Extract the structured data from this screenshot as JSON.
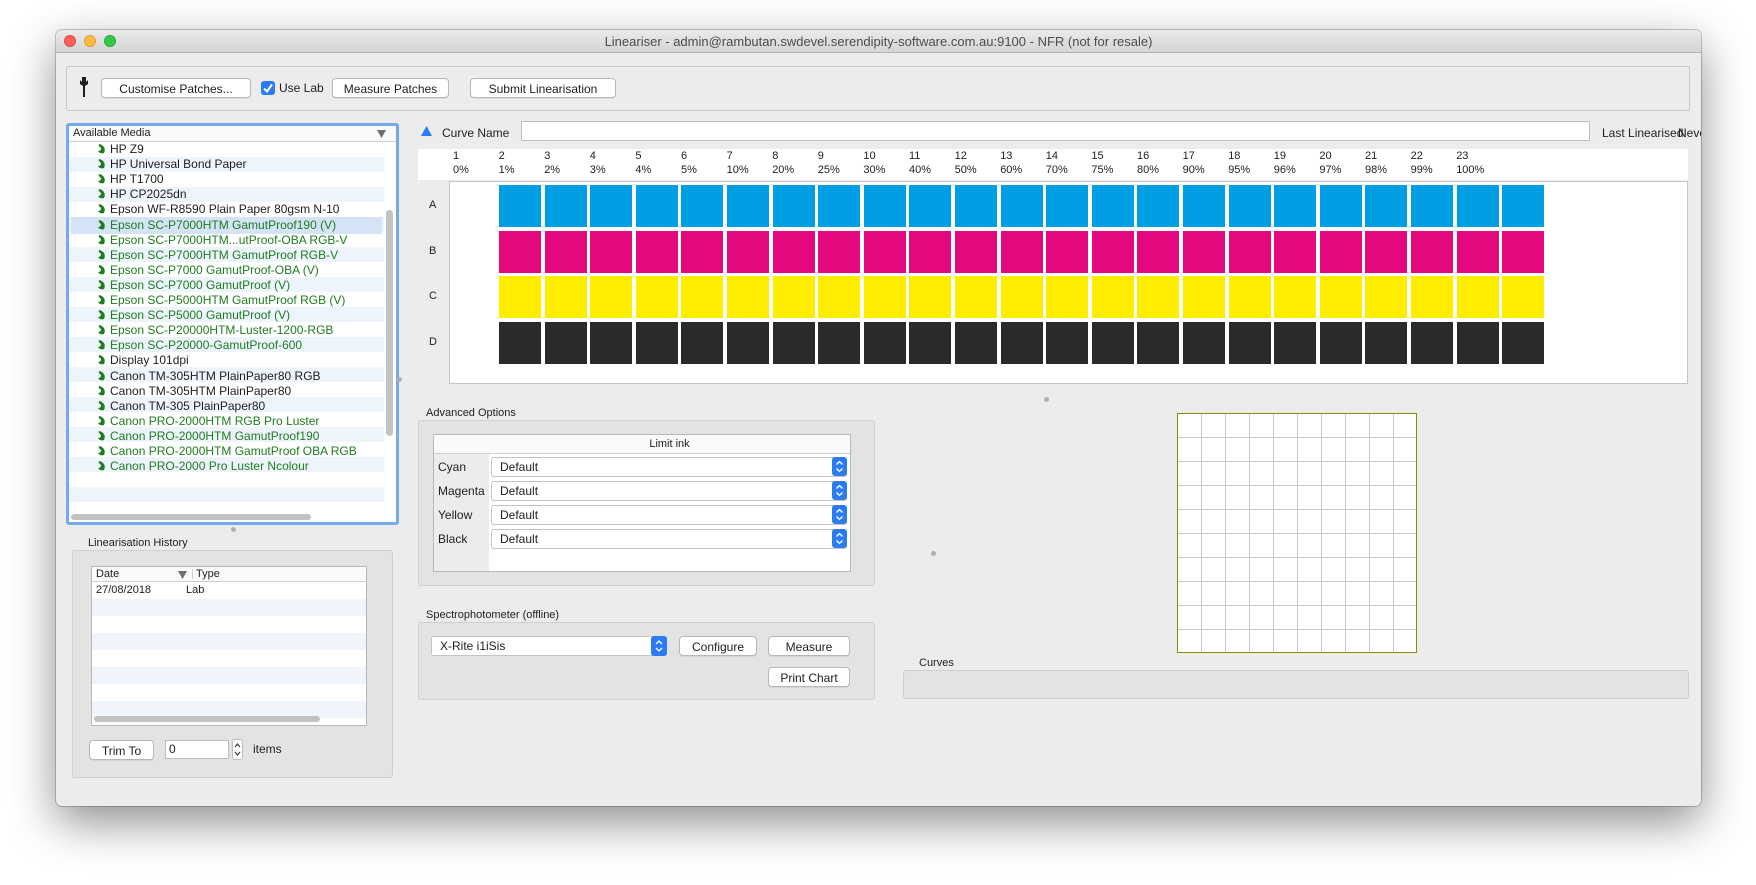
{
  "window": {
    "title": "Lineariser - admin@rambutan.swdevel.serendipity-software.com.au:9100 - NFR (not for resale)"
  },
  "toolbar": {
    "customise_label": "Customise Patches...",
    "use_lab_label": "Use Lab",
    "use_lab_checked": true,
    "measure_label": "Measure Patches",
    "submit_label": "Submit Linearisation"
  },
  "media": {
    "header": "Available Media",
    "items": [
      {
        "name": "HP Z9",
        "color": "#1e1e1e"
      },
      {
        "name": "HP Universal Bond Paper",
        "color": "#1e1e1e"
      },
      {
        "name": "HP T1700",
        "color": "#1e1e1e"
      },
      {
        "name": "HP CP2025dn",
        "color": "#1e1e1e"
      },
      {
        "name": "Epson WF-R8590 Plain Paper 80gsm N-10",
        "color": "#1e1e1e"
      },
      {
        "name": "Epson SC-P7000HTM GamutProof190 (V)",
        "color": "#1e7d1e",
        "selected": true
      },
      {
        "name": "Epson SC-P7000HTM...utProof-OBA RGB-V",
        "color": "#1e7d1e"
      },
      {
        "name": "Epson SC-P7000HTM GamutProof RGB-V",
        "color": "#1e7d1e"
      },
      {
        "name": "Epson SC-P7000 GamutProof-OBA (V)",
        "color": "#1e7d1e"
      },
      {
        "name": "Epson SC-P7000 GamutProof (V)",
        "color": "#1e7d1e"
      },
      {
        "name": "Epson SC-P5000HTM GamutProof RGB (V)",
        "color": "#1e7d1e"
      },
      {
        "name": "Epson SC-P5000 GamutProof (V)",
        "color": "#1e7d1e"
      },
      {
        "name": "Epson SC-P20000HTM-Luster-1200-RGB",
        "color": "#1e7d1e"
      },
      {
        "name": "Epson SC-P20000-GamutProof-600",
        "color": "#1e7d1e"
      },
      {
        "name": "Display 101dpi",
        "color": "#1e1e1e"
      },
      {
        "name": "Canon TM-305HTM PlainPaper80 RGB",
        "color": "#1e1e1e"
      },
      {
        "name": "Canon TM-305HTM PlainPaper80",
        "color": "#1e1e1e"
      },
      {
        "name": "Canon TM-305 PlainPaper80",
        "color": "#1e1e1e"
      },
      {
        "name": "Canon PRO-2000HTM RGB Pro Luster",
        "color": "#1e7d1e"
      },
      {
        "name": "Canon PRO-2000HTM GamutProof190",
        "color": "#1e7d1e"
      },
      {
        "name": "Canon PRO-2000HTM GamutProof OBA RGB",
        "color": "#1e7d1e"
      },
      {
        "name": "Canon PRO-2000 Pro Luster Ncolour",
        "color": "#1e7d1e"
      }
    ]
  },
  "history": {
    "title": "Linearisation History",
    "col_date": "Date",
    "col_type": "Type",
    "rows": [
      {
        "date": "27/08/2018",
        "type": "Lab"
      }
    ],
    "trim_label": "Trim To",
    "trim_value": "0",
    "items_label": "items"
  },
  "curve": {
    "name_label": "Curve Name",
    "name_value": "",
    "last_linearised_label": "Last Linearised:",
    "last_linearised_value": "Never"
  },
  "patches": {
    "columns": [
      {
        "num": "1",
        "pct": "0%"
      },
      {
        "num": "2",
        "pct": "1%"
      },
      {
        "num": "3",
        "pct": "2%"
      },
      {
        "num": "4",
        "pct": "3%"
      },
      {
        "num": "5",
        "pct": "4%"
      },
      {
        "num": "6",
        "pct": "5%"
      },
      {
        "num": "7",
        "pct": "10%"
      },
      {
        "num": "8",
        "pct": "20%"
      },
      {
        "num": "9",
        "pct": "25%"
      },
      {
        "num": "10",
        "pct": "30%"
      },
      {
        "num": "11",
        "pct": "40%"
      },
      {
        "num": "12",
        "pct": "50%"
      },
      {
        "num": "13",
        "pct": "60%"
      },
      {
        "num": "14",
        "pct": "70%"
      },
      {
        "num": "15",
        "pct": "75%"
      },
      {
        "num": "16",
        "pct": "80%"
      },
      {
        "num": "17",
        "pct": "90%"
      },
      {
        "num": "18",
        "pct": "95%"
      },
      {
        "num": "19",
        "pct": "96%"
      },
      {
        "num": "20",
        "pct": "97%"
      },
      {
        "num": "21",
        "pct": "98%"
      },
      {
        "num": "22",
        "pct": "99%"
      },
      {
        "num": "23",
        "pct": "100%"
      }
    ],
    "rows": [
      {
        "label": "A",
        "color": "#009fe3"
      },
      {
        "label": "B",
        "color": "#e5097f"
      },
      {
        "label": "C",
        "color": "#ffed00"
      },
      {
        "label": "D",
        "color": "#2a2a2a"
      }
    ]
  },
  "advanced": {
    "title": "Advanced Options",
    "limit_header": "Limit ink",
    "rows": [
      {
        "label": "Cyan",
        "value": "Default"
      },
      {
        "label": "Magenta",
        "value": "Default"
      },
      {
        "label": "Yellow",
        "value": "Default"
      },
      {
        "label": "Black",
        "value": "Default"
      }
    ]
  },
  "spectro": {
    "title": "Spectrophotometer (offline)",
    "device": "X-Rite i1iSis",
    "configure_label": "Configure",
    "measure_label": "Measure",
    "print_label": "Print Chart"
  },
  "curves": {
    "title": "Curves"
  },
  "colors": {
    "accent": "#2b7cf4",
    "grid_border": "#8a8a00",
    "selected_row": "#d4e3f5"
  }
}
